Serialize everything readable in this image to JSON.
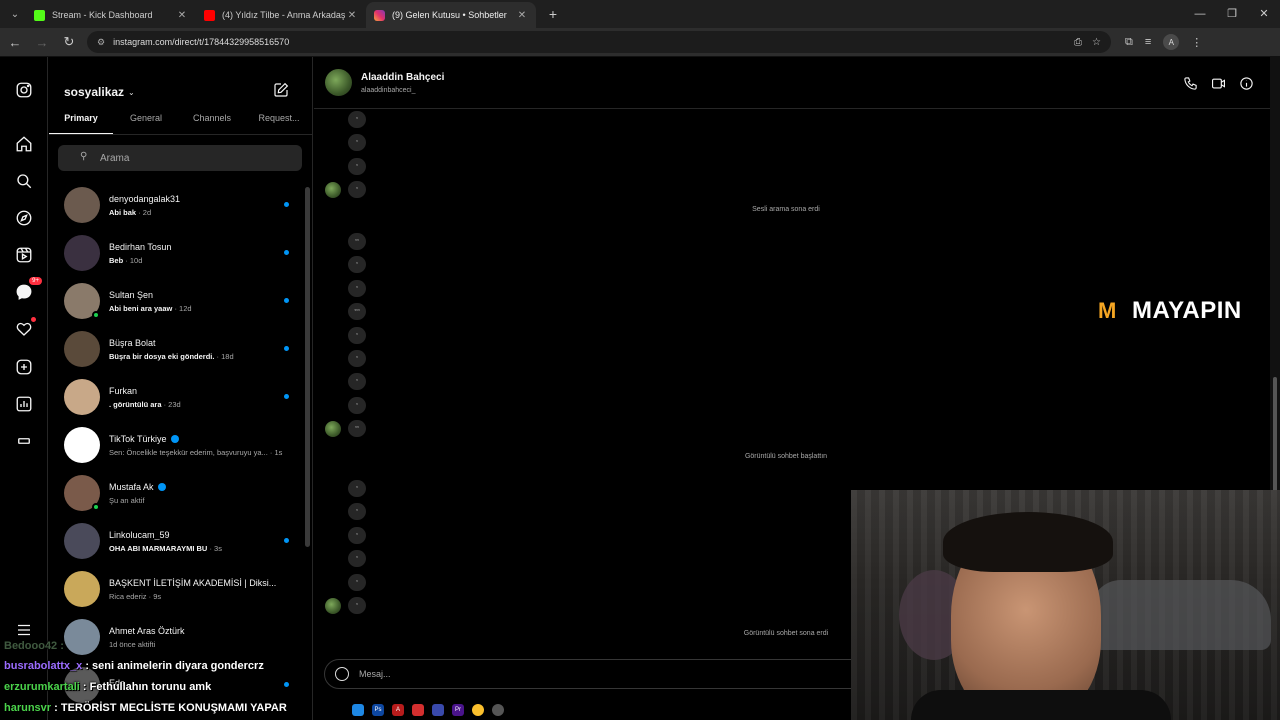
{
  "browser": {
    "tabs": [
      {
        "title": "Stream - Kick Dashboard",
        "favicon_color": "#53fc18",
        "active": false
      },
      {
        "title": "(4) Yıldız Tilbe - Anma Arkadaş",
        "favicon_color": "#ff0000",
        "active": false
      },
      {
        "title": "(9) Gelen Kutusu • Sohbetler",
        "favicon_color": "#e1306c",
        "active": true
      }
    ],
    "url": "instagram.com/direct/t/17844329958516570",
    "profile_initial": "A"
  },
  "rail": {
    "messages_badge": "9+"
  },
  "inbox": {
    "account_name": "sosyalikaz",
    "tabs": [
      "Primary",
      "General",
      "Channels",
      "Request..."
    ],
    "search_placeholder": "Arama",
    "conversations": [
      {
        "name": "denyodangalak31",
        "message": "Abi bak",
        "time": "· 2d",
        "unread": true,
        "bold": true,
        "avatar": "#6b5a4e",
        "verified": false,
        "online": false
      },
      {
        "name": "Bedirhan Tosun",
        "message": "Beb",
        "time": "· 10d",
        "unread": true,
        "bold": true,
        "avatar": "#3a3040",
        "verified": false,
        "online": false
      },
      {
        "name": "Sultan Şen",
        "message": "Abi beni ara yaaw",
        "time": "· 12d",
        "unread": true,
        "bold": true,
        "avatar": "#8a7a6a",
        "verified": false,
        "online": true
      },
      {
        "name": "Büşra Bolat",
        "message": "Büşra bir dosya eki gönderdi.",
        "time": "· 18d",
        "unread": true,
        "bold": true,
        "avatar": "#5a4a3a",
        "verified": false,
        "online": false
      },
      {
        "name": "Furkan",
        "message": ". görüntülü ara",
        "time": "· 23d",
        "unread": true,
        "bold": true,
        "avatar": "#c8a888",
        "verified": false,
        "online": false
      },
      {
        "name": "TikTok Türkiye",
        "message": "Sen: Öncelikle teşekkür ederim, başvuruyu ya...",
        "time": "· 1s",
        "unread": false,
        "bold": false,
        "avatar": "#ffffff",
        "verified": true,
        "online": false
      },
      {
        "name": "Mustafa Ak",
        "message": "Şu an aktif",
        "time": "",
        "unread": false,
        "bold": false,
        "avatar": "#7a5a4a",
        "verified": true,
        "online": true
      },
      {
        "name": "Linkolucam_59",
        "message": "OHA ABI MARMARAYMI BU",
        "time": "· 3s",
        "unread": true,
        "bold": true,
        "avatar": "#4a4a5a",
        "verified": false,
        "online": false
      },
      {
        "name": "BAŞKENT İLETİŞİM AKADEMİSİ | Diksi...",
        "message": "Rica ederiz",
        "time": "· 9s",
        "unread": false,
        "bold": false,
        "avatar": "#c9a85a",
        "verified": false,
        "online": false
      },
      {
        "name": "Ahmet Aras Öztürk",
        "message": "1d önce aktifti",
        "time": "",
        "unread": false,
        "bold": false,
        "avatar": "#7a8a9a",
        "verified": false,
        "online": false
      },
      {
        "name": "Eda",
        "message": "",
        "time": "",
        "unread": true,
        "bold": false,
        "avatar": "#5a5a5a",
        "verified": false,
        "online": false
      }
    ]
  },
  "chat": {
    "name": "Alaaddin Bahçeci",
    "username": "alaaddinbahceci_",
    "system_messages": [
      "Sesli arama sona erdi",
      "Görüntülü sohbet başlattın",
      "Görüntülü sohbet sona erdi"
    ],
    "message_placeholder": "Mesaj...",
    "group1": [
      ",",
      ",",
      ",",
      ","
    ],
    "group2": [
      ",,",
      ",",
      ",",
      ",,,",
      ",",
      ",",
      ",",
      ",",
      ",,"
    ],
    "group3": [
      ",",
      ",",
      ",",
      ",",
      ",",
      ","
    ]
  },
  "overlay": {
    "logo_text": "MAYAPIN",
    "twitch_chat": [
      {
        "user": "Bedooo42 :",
        "text": "",
        "ghost": true
      },
      {
        "user": "busrabolattx_x",
        "text": ": seni animelerin diyara gondercrz",
        "ghost": false
      },
      {
        "user": "erzurumkartali",
        "text": ": Fethullahın torunu amk",
        "ghost": false
      },
      {
        "user": "harunsvr",
        "text": ": TERÖRİST MECLİSTE KONUŞMAMI YAPAR",
        "ghost": false
      }
    ]
  }
}
